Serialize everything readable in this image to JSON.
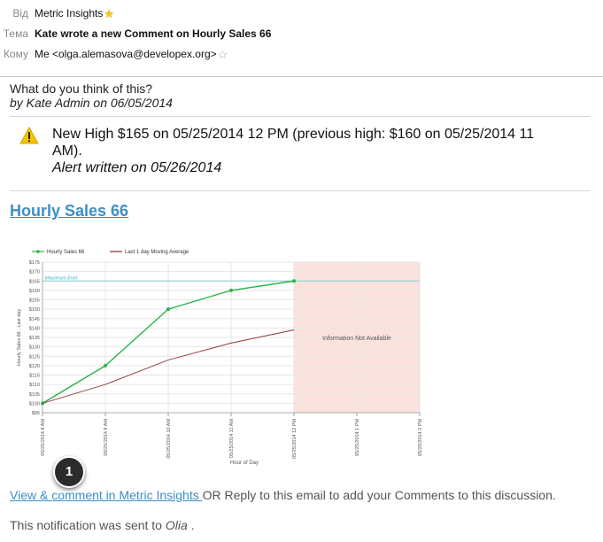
{
  "email": {
    "from_label": "Від",
    "from_value": "Metric Insights",
    "subject_label": "Тема",
    "subject_value": "Kate wrote a new Comment on Hourly Sales 66",
    "to_label": "Кому",
    "to_value": "Me <olga.alemasova@developex.org>"
  },
  "comment": {
    "question": "What do you think of this?",
    "byline": "by Kate Admin on 06/05/2014"
  },
  "alert": {
    "icon": "warning-icon",
    "line1": "New High $165 on 05/25/2014 12 PM   (previous high: $160 on 05/25/2014 11",
    "line2": "AM).",
    "line3": "Alert written on 05/26/2014"
  },
  "metric_title": "Hourly Sales 66",
  "chart_data": {
    "type": "line",
    "legend_position": "top-left",
    "series": [
      {
        "name": "Hourly Sales 66",
        "color": "#2bb34a",
        "markers": true,
        "values": [
          100,
          120,
          150,
          160,
          165
        ]
      },
      {
        "name": "Last 1 day Moving Average",
        "color": "#8b2a2a",
        "markers": false,
        "values": [
          100,
          110,
          123,
          132,
          139
        ]
      }
    ],
    "categories": [
      "05/25/2014 8 AM",
      "05/25/2014 9 AM",
      "05/25/2014 10 AM",
      "05/25/2014 11 AM",
      "05/25/2014 12 PM",
      "05/25/2014 1 PM",
      "05/25/2014 2 PM"
    ],
    "ylim": [
      95,
      175
    ],
    "yticks": [
      "$95",
      "$100",
      "$105",
      "$110",
      "$115",
      "$120",
      "$125",
      "$130",
      "$135",
      "$140",
      "$145",
      "$150",
      "$155",
      "$160",
      "$165",
      "$170",
      "$175"
    ],
    "ylabel": "Hourly Sales 66 , Last day",
    "xlabel": "Hour of Day",
    "reference_line": {
      "label": "Maximum Ever",
      "value": 165,
      "color": "#7fd0d8"
    },
    "unavailable_region": {
      "from_index": 4,
      "to_index": 6,
      "label": "Information Not Available",
      "color": "#fbe2dc"
    },
    "grid": true
  },
  "badge_number": "1",
  "footer": {
    "link_text": "View & comment in Metric Insights ",
    "rest_text": "OR Reply to this email to add your Comments to this discussion.",
    "notice_prefix": "This notification was sent to ",
    "notice_name": "Olia",
    "notice_suffix": " ."
  }
}
